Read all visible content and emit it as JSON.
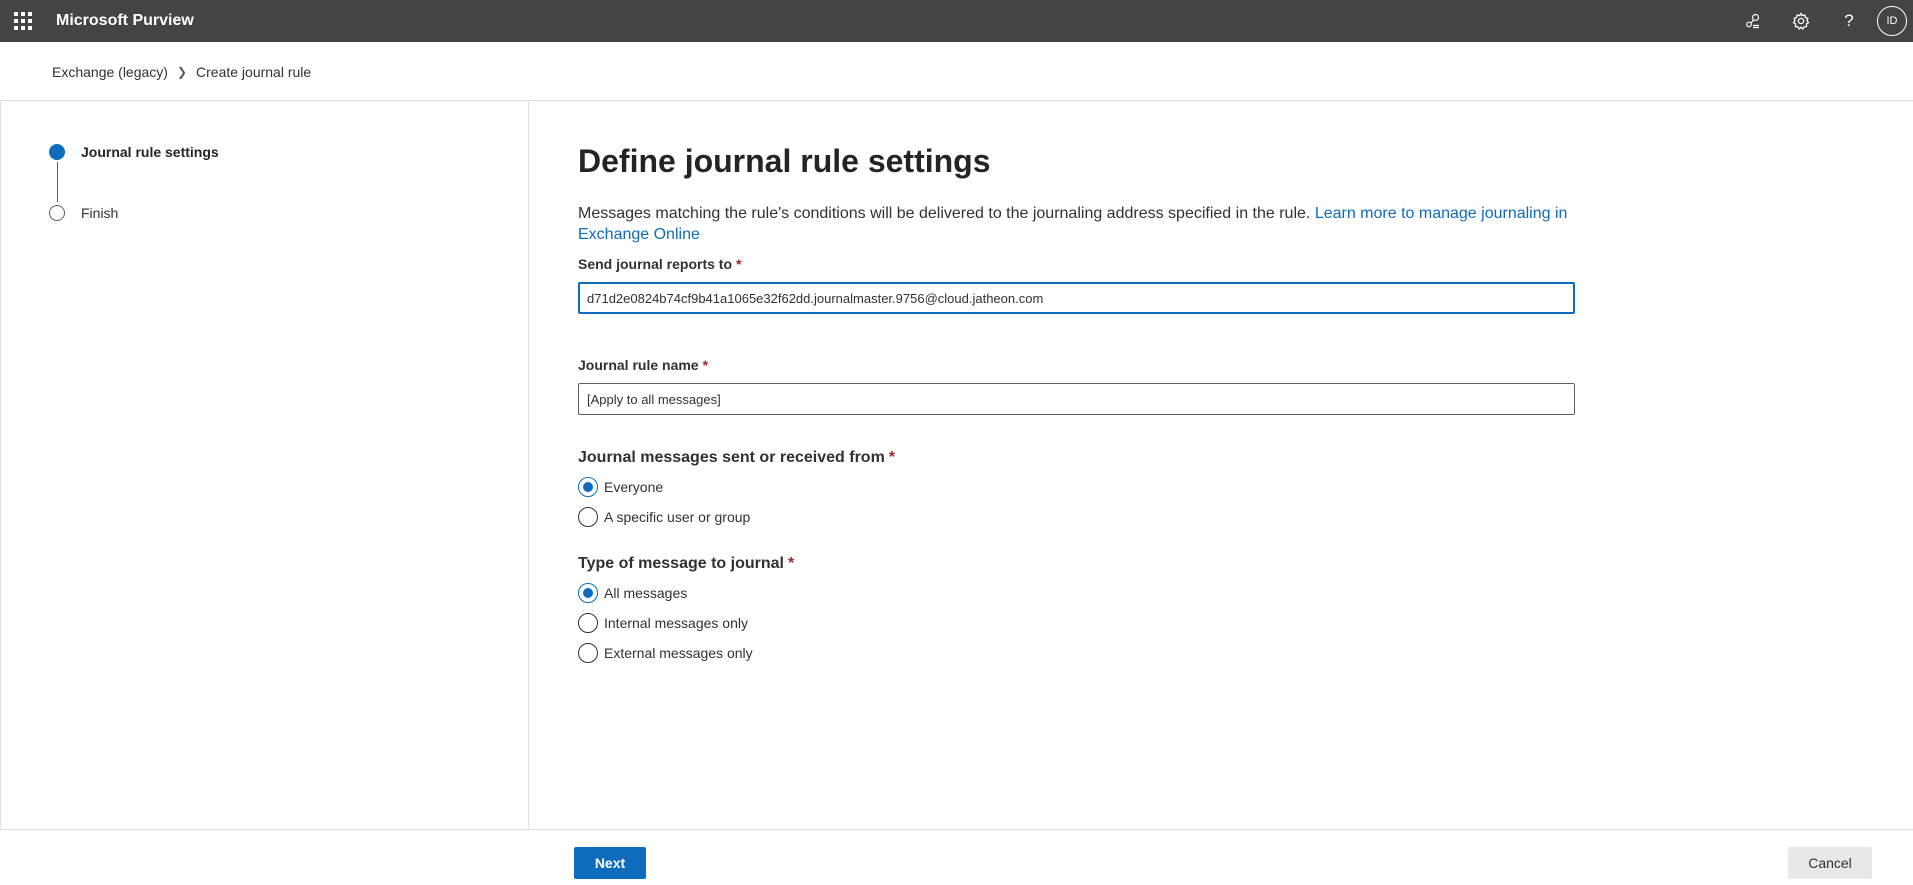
{
  "header": {
    "app_title": "Microsoft Purview",
    "icons": [
      "waffle-icon",
      "connections-icon",
      "settings-icon",
      "help-icon"
    ],
    "avatar_initials": "ID"
  },
  "breadcrumb": {
    "items": [
      "Exchange (legacy)",
      "Create journal rule"
    ]
  },
  "stepper": {
    "steps": [
      {
        "label": "Journal rule settings",
        "state": "current"
      },
      {
        "label": "Finish",
        "state": "pending"
      }
    ]
  },
  "main": {
    "title": "Define journal rule settings",
    "description": "Messages matching the rule's conditions will be delivered to the journaling address specified in the rule.",
    "learn_more_link": "Learn more to manage journaling in Exchange Online",
    "send_reports": {
      "label": "Send journal reports to",
      "required_mark": "*",
      "value": "d71d2e0824b74cf9b41a1065e32f62dd.journalmaster.9756@cloud.jatheon.com"
    },
    "rule_name": {
      "label": "Journal rule name",
      "required_mark": "*",
      "value": "[Apply to all messages]"
    },
    "sent_received": {
      "label": "Journal messages sent or received from",
      "required_mark": "*",
      "options": [
        "Everyone",
        "A specific user or group"
      ],
      "selected": "Everyone"
    },
    "message_type": {
      "label": "Type of message to journal",
      "required_mark": "*",
      "options": [
        "All messages",
        "Internal messages only",
        "External messages only"
      ],
      "selected": "All messages"
    }
  },
  "footer": {
    "next_label": "Next",
    "cancel_label": "Cancel"
  },
  "colors": {
    "accent": "#0f6cbd",
    "topbar": "#444444",
    "required": "#a4262c"
  }
}
